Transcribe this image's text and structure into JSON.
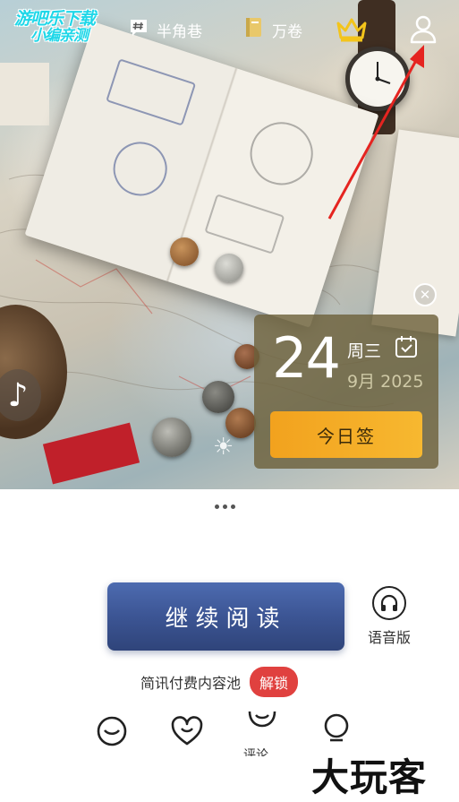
{
  "watermark": {
    "line1": "游吧乐下载",
    "line2": "小编亲测"
  },
  "nav": {
    "items": [
      {
        "label": "半角巷",
        "icon": "hashtag-chat-icon"
      },
      {
        "label": "万卷",
        "icon": "book-icon"
      }
    ],
    "vip_icon": "crown-icon",
    "profile_icon": "user-icon"
  },
  "calendar": {
    "day": "24",
    "weekday": "周三",
    "month_year": "9月 2025",
    "sign_label": "今日签",
    "close_icon": "close-icon",
    "calendar_icon": "calendar-check-icon"
  },
  "music_icon": "music-note-icon",
  "main": {
    "continue_label": "继续阅读",
    "audio_label": "语音版",
    "unlock_text": "简讯付费内容池",
    "unlock_label": "解锁"
  },
  "bottom": {
    "comment_label": "评论",
    "brand": "大玩客"
  },
  "colors": {
    "accent_orange": "#f2a21e",
    "primary_blue": "#3c5594",
    "unlock_red": "#e0413f",
    "calendar_bg": "#6e623c"
  }
}
